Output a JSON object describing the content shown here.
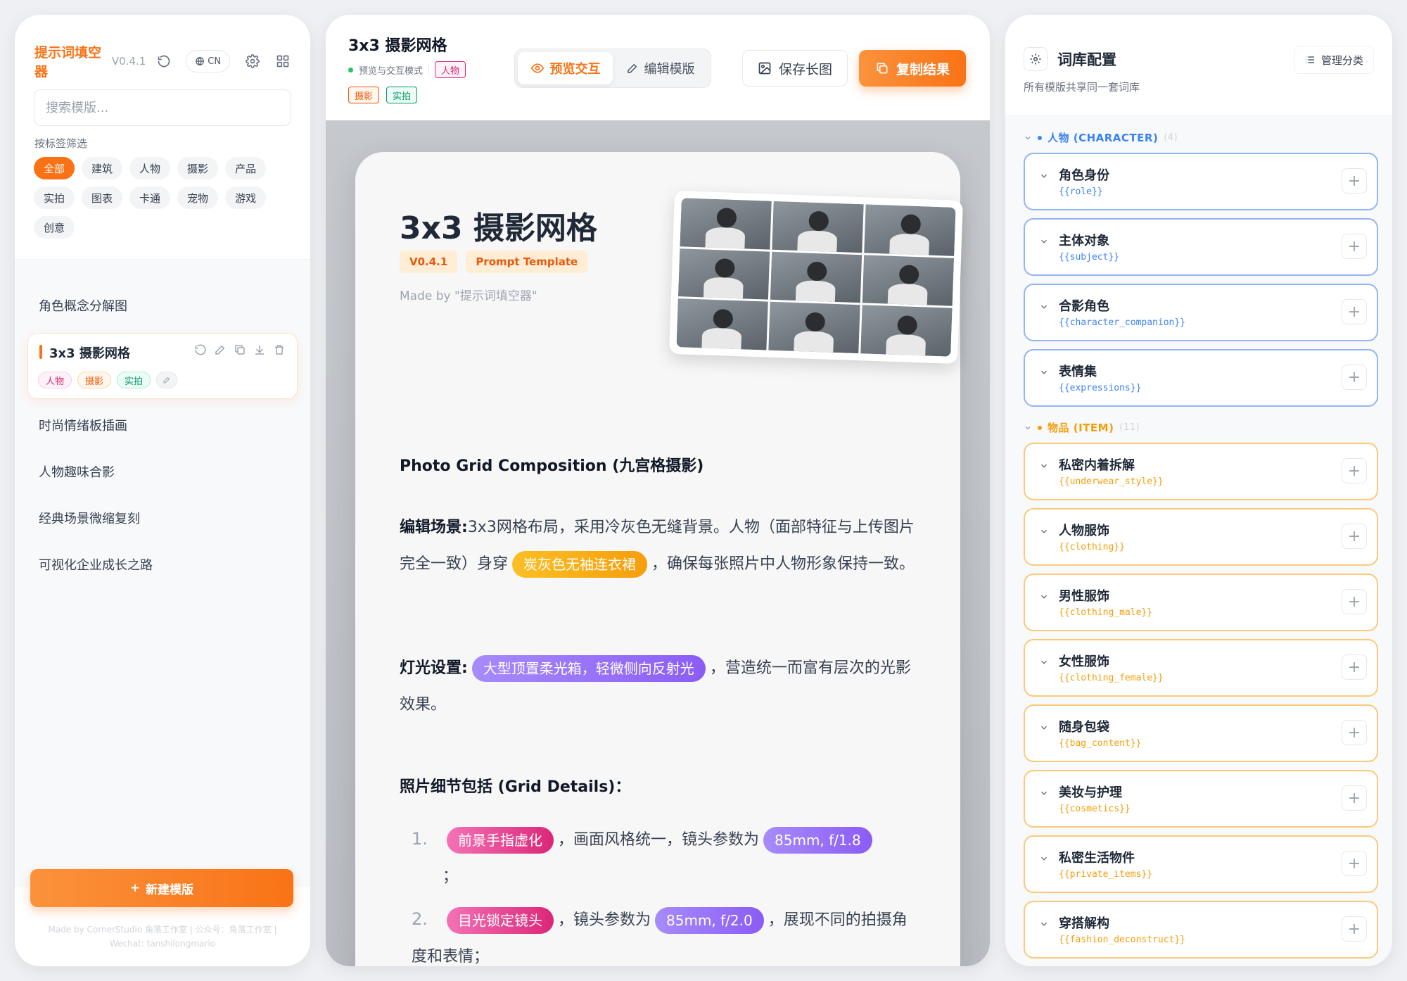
{
  "left": {
    "brand": "提示词填空器",
    "version": "V0.4.1",
    "lang": "CN",
    "search_placeholder": "搜索模版...",
    "filter_label": "按标签筛选",
    "tags": [
      "全部",
      "建筑",
      "人物",
      "摄影",
      "产品",
      "实拍",
      "图表",
      "卡通",
      "宠物",
      "游戏",
      "创意"
    ],
    "templates": [
      "角色概念分解图",
      "3x3 摄影网格",
      "时尚情绪板插画",
      "人物趣味合影",
      "经典场景微缩复刻",
      "可视化企业成长之路"
    ],
    "active_template": {
      "title": "3x3 摄影网格",
      "tags": [
        "人物",
        "摄影",
        "实拍"
      ]
    },
    "new_button": "新建模版",
    "credits_line1": "Made by CornerStudio 角落工作室 | 公众号：角落工作室 |",
    "credits_line2": "Wechat: tanshilongmario"
  },
  "mid": {
    "title": "3x3 摄影网格",
    "mode_label": "预览与交互模式",
    "meta_tag": "人物",
    "tags": [
      "摄影",
      "实拍"
    ],
    "mode_preview": "预览交互",
    "mode_edit": "编辑模版",
    "save_button": "保存长图",
    "copy_button": "复制结果",
    "paper": {
      "title": "3x3 摄影网格",
      "badge_version": "V0.4.1",
      "badge_type": "Prompt Template",
      "made_by": "Made by \"提示词填空器\"",
      "section1": "Photo Grid Composition (九宫格摄影)",
      "scene_label": "编辑场景:",
      "scene_text_1": "3x3网格布局，采用冷灰色无缝背景。人物（面部特征与上传图片完全一致）身穿",
      "scene_chip": "炭灰色无袖连衣裙",
      "scene_text_2": "，确保每张照片中人物形象保持一致。",
      "light_label": "灯光设置:",
      "light_chip": "大型顶置柔光箱，轻微侧向反射光",
      "light_text": "，营造统一而富有层次的光影效果。",
      "section2": "照片细节包括 (Grid Details)：",
      "item1_num": "1.",
      "item1_chip": "前景手指虚化",
      "item1_text": "，画面风格统一，镜头参数为",
      "item1_chip2": "85mm, f/1.8",
      "item1_end": "；",
      "item2_num": "2.",
      "item2_chip": "目光锁定镜头",
      "item2_text": "，镜头参数为",
      "item2_chip2": "85mm, f/2.0",
      "item2_text2": "，展现不同的拍摄角度和表情；"
    }
  },
  "right": {
    "title": "词库配置",
    "subtitle": "所有模版共享同一套词库",
    "manage_button": "管理分类",
    "groups": [
      {
        "name": "人物 (CHARACTER)",
        "count": "(4)",
        "color": "#3b82f6",
        "items": [
          {
            "name": "角色身份",
            "key": "{{role}}"
          },
          {
            "name": "主体对象",
            "key": "{{subject}}"
          },
          {
            "name": "合影角色",
            "key": "{{character_companion}}"
          },
          {
            "name": "表情集",
            "key": "{{expressions}}"
          }
        ]
      },
      {
        "name": "物品 (ITEM)",
        "count": "(11)",
        "color": "#f59e0b",
        "items": [
          {
            "name": "私密内着拆解",
            "key": "{{underwear_style}}"
          },
          {
            "name": "人物服饰",
            "key": "{{clothing}}"
          },
          {
            "name": "男性服饰",
            "key": "{{clothing_male}}"
          },
          {
            "name": "女性服饰",
            "key": "{{clothing_female}}"
          },
          {
            "name": "随身包袋",
            "key": "{{bag_content}}"
          },
          {
            "name": "美妆与护理",
            "key": "{{cosmetics}}"
          },
          {
            "name": "私密生活物件",
            "key": "{{private_items}}"
          },
          {
            "name": "穿搭解构",
            "key": "{{fashion_deconstruct}}"
          }
        ]
      }
    ]
  }
}
